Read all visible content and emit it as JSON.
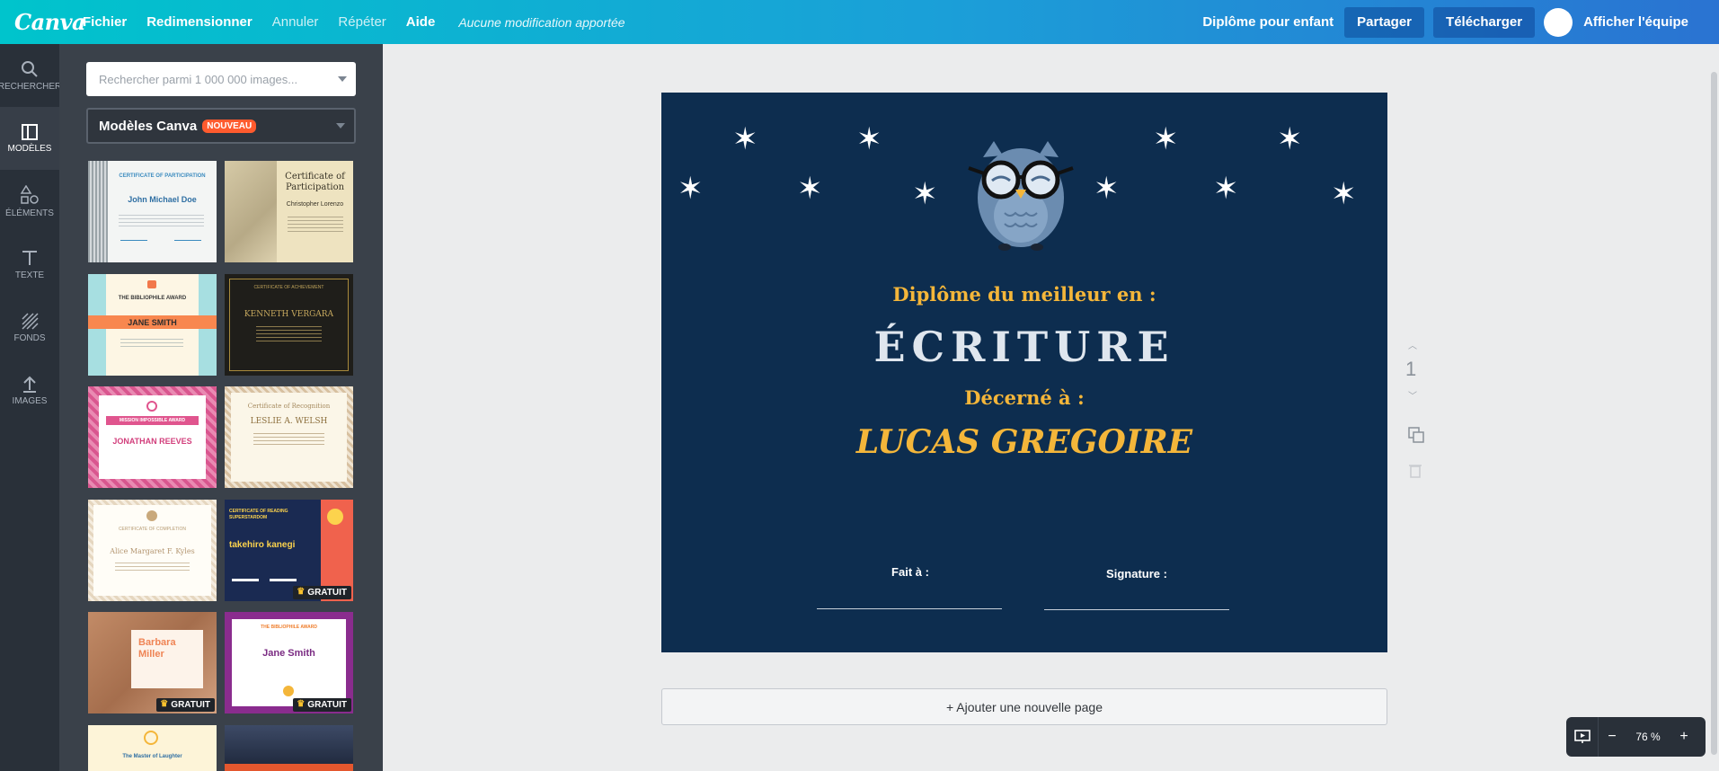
{
  "topbar": {
    "logo": "Canva",
    "menu": [
      "Fichier",
      "Redimensionner",
      "Annuler",
      "Répéter",
      "Aide"
    ],
    "status": "Aucune modification apportée",
    "doc_title": "Diplôme pour enfant",
    "share": "Partager",
    "download": "Télécharger",
    "team": "Afficher l'équipe"
  },
  "rail": [
    {
      "label": "RECHERCHER",
      "icon": "search-icon"
    },
    {
      "label": "MODÈLES",
      "icon": "layout-icon"
    },
    {
      "label": "ÉLÉMENTS",
      "icon": "shapes-icon"
    },
    {
      "label": "TEXTE",
      "icon": "text-icon"
    },
    {
      "label": "FONDS",
      "icon": "background-icon"
    },
    {
      "label": "IMAGES",
      "icon": "upload-icon"
    }
  ],
  "panel": {
    "search_placeholder": "Rechercher parmi 1 000 000 images...",
    "dropdown_label": "Modèles Canva",
    "badge": "NOUVEAU",
    "gratuit": "GRATUIT",
    "thumbs": [
      {
        "title": "CERTIFICATE OF PARTICIPATION",
        "name": "John Michael Doe"
      },
      {
        "title": "Certificate of Participation",
        "name": "Christopher Lorenzo"
      },
      {
        "title": "THE BIBLIOPHILE AWARD",
        "name": "JANE SMITH"
      },
      {
        "title": "CERTIFICATE OF ACHIEVEMENT",
        "name": "KENNETH VERGARA"
      },
      {
        "title": "MISSION IMPOSSIBLE AWARD",
        "name": "JONATHAN REEVES"
      },
      {
        "title": "Certificate of Recognition",
        "name": "LESLIE A. WELSH"
      },
      {
        "title": "CERTIFICATE OF COMPLETION",
        "name": "Alice Margaret F. Kyles"
      },
      {
        "title": "CERTIFICATE OF READING SUPERSTARDOM",
        "name": "takehiro kanegi"
      },
      {
        "title": "",
        "name": "Barbara Miller"
      },
      {
        "title": "THE BIBLIOPHILE AWARD",
        "name": "Jane Smith"
      },
      {
        "title": "",
        "name": "The Master of Laughter"
      },
      {
        "title": "",
        "name": ""
      }
    ]
  },
  "certificate": {
    "line1": "Diplôme du meilleur en :",
    "subject": "ÉCRITURE",
    "line2": "Décerné à :",
    "recipient": "LUCAS GREGOIRE",
    "left_label": "Fait à :",
    "right_label": "Signature :"
  },
  "add_page": "+ Ajouter une nouvelle page",
  "page_number": "1",
  "zoom_level": "76 %",
  "colors": {
    "accent_gold": "#f4b63a",
    "cert_bg": "#0d2d4f",
    "subject": "#dfe6ee"
  }
}
